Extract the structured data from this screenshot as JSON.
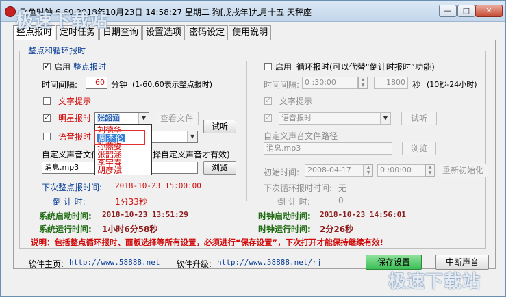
{
  "window": {
    "title": "飞鱼时钟 6.60 2018年10月23日 14:58:27 星期二 狗[戊戌年]九月十五 天秤座",
    "min_label": "—",
    "max_label": "□",
    "close_label": "✕"
  },
  "tabs": [
    "整点报时",
    "定时任务",
    "日期查询",
    "设置选项",
    "密码设定",
    "使用说明"
  ],
  "group_title": "整点和循环报时",
  "left": {
    "enable_label": "启用",
    "enable_name": "整点报时",
    "interval_label": "时间间隔:",
    "interval_value": "60",
    "interval_unit": "分钟",
    "interval_hint": "(1-60,60表示整点报时)",
    "text_prompt_label": "文字提示",
    "star_label": "明星报时",
    "star_selected": "张韶涵",
    "view_file_label": "查看文件",
    "listen_label": "试听",
    "voice_label": "语音报时",
    "custom_path_label_a": "自定义声音文件",
    "custom_path_label_b": "择自定义声音才有效)",
    "custom_path_value": "消息.mp3",
    "browse_label": "浏览",
    "next_label": "下次整点报时间:",
    "next_value": "2018-10-23 15:00:00",
    "countdown_label": "倒 计 时:",
    "countdown_value": "1分33秒",
    "sys_start_label": "系统启动时间:",
    "sys_start_value": "2018-10-23 13:51:29",
    "sys_run_label": "系统运行时间:",
    "sys_run_value": "1小时6分58秒"
  },
  "dropdown": {
    "items": [
      "刘德华",
      "周杰伦",
      "孙燕姿",
      "张韶涵",
      "李宇春",
      "胡彦斌"
    ],
    "selected_index": 1
  },
  "right": {
    "enable_label": "启用",
    "enable_name": "循环报时(可以代替“倒计时报时”功能)",
    "interval_label": "时间间隔:",
    "interval_value": "0 :30:00",
    "seconds_value": "1800",
    "seconds_unit": "秒",
    "seconds_hint": "(10秒-24小时)",
    "text_prompt_label": "文字提示",
    "voice_selected": "语音报时",
    "listen_label": "试听",
    "custom_path_label": "自定义声音文件路径",
    "custom_path_value": "消息.mp3",
    "browse_label": "浏览",
    "init_label": "初始时间:",
    "init_date": "2008-04-17",
    "init_time": "0 :00:00",
    "reinit_label": "重新初始化",
    "next_label": "下次循环报时时间:",
    "next_value": "无",
    "countdown_label": "倒 计 时:",
    "countdown_value": "0",
    "clock_start_label": "时钟启动时间:",
    "clock_start_value": "2018-10-23 14:56:01",
    "clock_run_label": "时钟运行时间:",
    "clock_run_value": "2分26秒"
  },
  "notice": "说明：包括整点循环报时、面板选择等所有设置，必须进行“保存设置”，下次打开才能保持继续有效!",
  "footer": {
    "home_label": "软件主页:",
    "home_url": "http://www.58888.net",
    "upgrade_label": "软件升级:",
    "upgrade_url": "http://www.58888.net/rj",
    "save_label": "保存设置",
    "stop_label": "中断声音"
  },
  "watermarks": [
    "极速下载站",
    "极速下载站"
  ]
}
